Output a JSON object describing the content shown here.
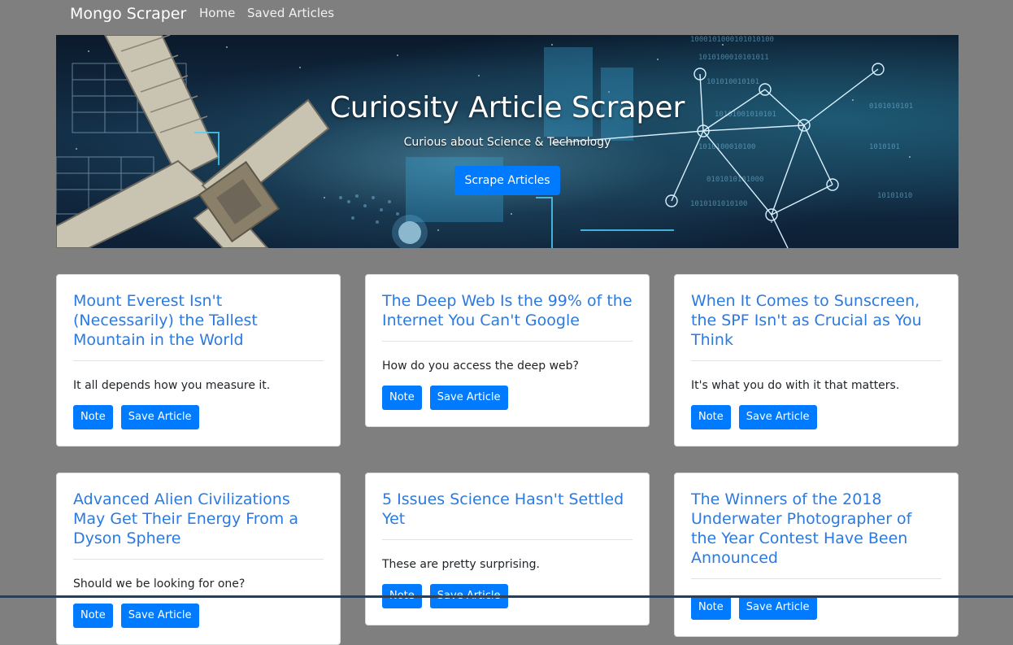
{
  "navbar": {
    "brand": "Mongo Scraper",
    "links": [
      {
        "label": "Home"
      },
      {
        "label": "Saved Articles"
      }
    ]
  },
  "hero": {
    "title": "Curiosity Article Scraper",
    "subtitle": "Curious about Science & Technology",
    "button_label": "Scrape Articles"
  },
  "articles": [
    {
      "title": "Mount Everest Isn't (Necessarily) the Tallest Mountain in the World",
      "summary": "It all depends how you measure it.",
      "note_label": "Note",
      "save_label": "Save Article"
    },
    {
      "title": "The Deep Web Is the 99% of the Internet You Can't Google",
      "summary": "How do you access the deep web?",
      "note_label": "Note",
      "save_label": "Save Article"
    },
    {
      "title": "When It Comes to Sunscreen, the SPF Isn't as Crucial as You Think",
      "summary": "It's what you do with it that matters.",
      "note_label": "Note",
      "save_label": "Save Article"
    },
    {
      "title": "Advanced Alien Civilizations May Get Their Energy From a Dyson Sphere",
      "summary": "Should we be looking for one?",
      "note_label": "Note",
      "save_label": "Save Article"
    },
    {
      "title": "5 Issues Science Hasn't Settled Yet",
      "summary": "These are pretty surprising.",
      "note_label": "Note",
      "save_label": "Save Article"
    },
    {
      "title": "The Winners of the 2018 Underwater Photographer of the Year Contest Have Been Announced",
      "summary": "",
      "note_label": "Note",
      "save_label": "Save Article"
    }
  ],
  "colors": {
    "page_background": "#7f7f7f",
    "accent": "#007bff",
    "link": "#2a7ae2"
  }
}
